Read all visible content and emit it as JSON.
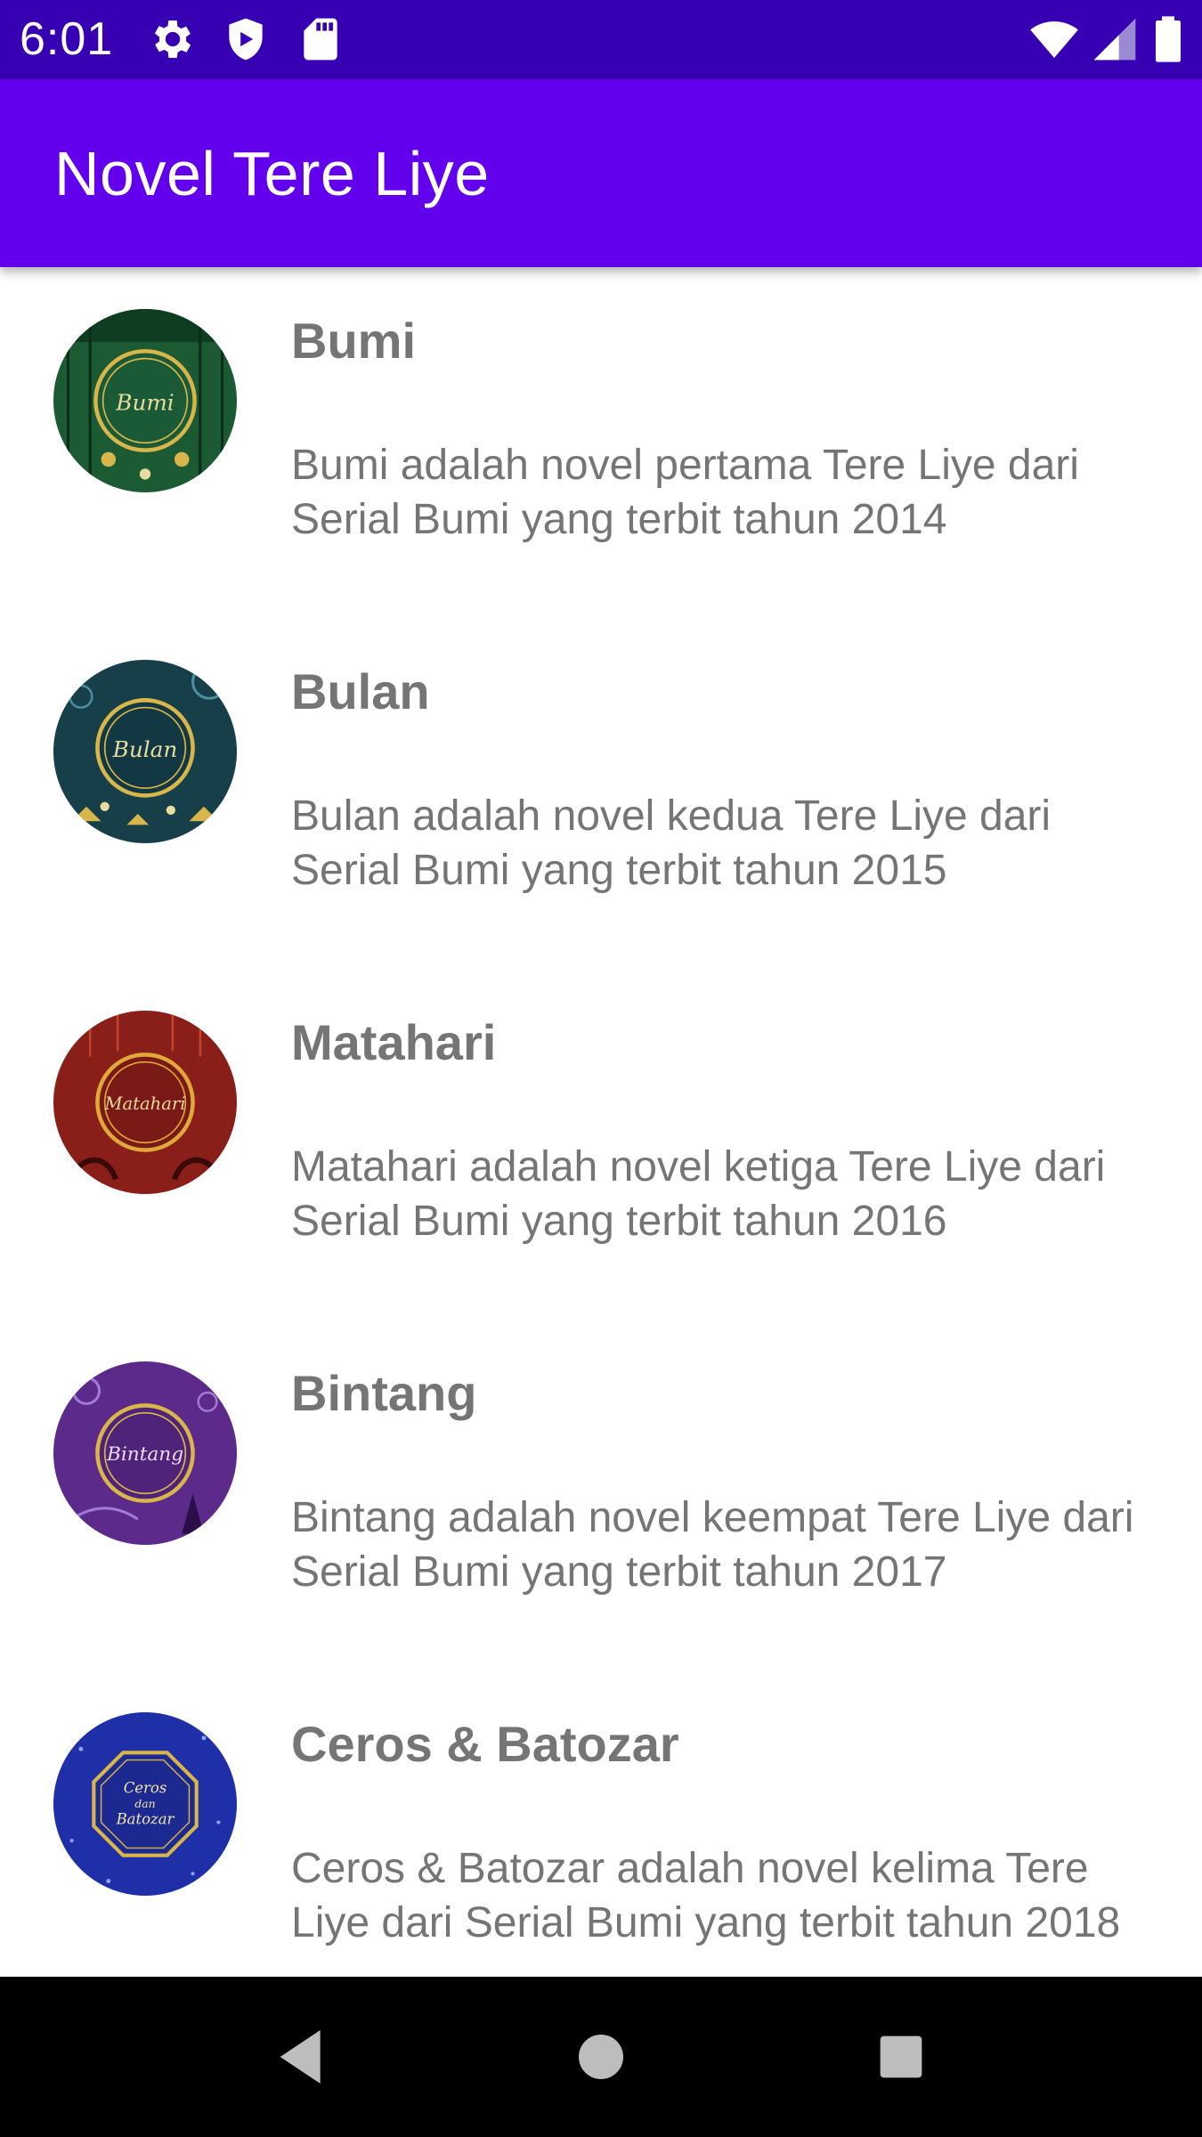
{
  "status_bar": {
    "time": "6:01",
    "icons": [
      "settings-icon",
      "shield-icon",
      "sd-card-icon",
      "wifi-icon",
      "signal-icon",
      "battery-icon"
    ]
  },
  "app_bar": {
    "title": "Novel Tere Liye",
    "color": "#6200ee",
    "status_color": "#3700b3"
  },
  "novels": [
    {
      "title": "Bumi",
      "description": "Bumi adalah novel pertama Tere Liye dari Serial Bumi yang terbit tahun 2014",
      "cover_text": "Bumi",
      "cover_color": "#1c5a34"
    },
    {
      "title": "Bulan",
      "description": "Bulan adalah novel kedua Tere Liye dari Serial Bumi yang terbit tahun 2015",
      "cover_text": "Bulan",
      "cover_color": "#163f4a"
    },
    {
      "title": "Matahari",
      "description": "Matahari adalah novel ketiga Tere Liye dari Serial Bumi yang terbit tahun 2016",
      "cover_text": "Matahari",
      "cover_color": "#8a1f1a"
    },
    {
      "title": "Bintang",
      "description": "Bintang adalah novel keempat Tere Liye dari Serial Bumi yang terbit tahun 2017",
      "cover_text": "Bintang",
      "cover_color": "#5b2a8a"
    },
    {
      "title": "Ceros & Batozar",
      "description": "Ceros & Batozar adalah novel kelima Tere Liye dari Serial Bumi yang terbit tahun 2018",
      "cover_text": "Ceros dan Batozar",
      "cover_color": "#1f2fa8"
    }
  ],
  "nav_bar": {
    "buttons": [
      "back-icon",
      "home-icon",
      "recents-icon"
    ]
  }
}
